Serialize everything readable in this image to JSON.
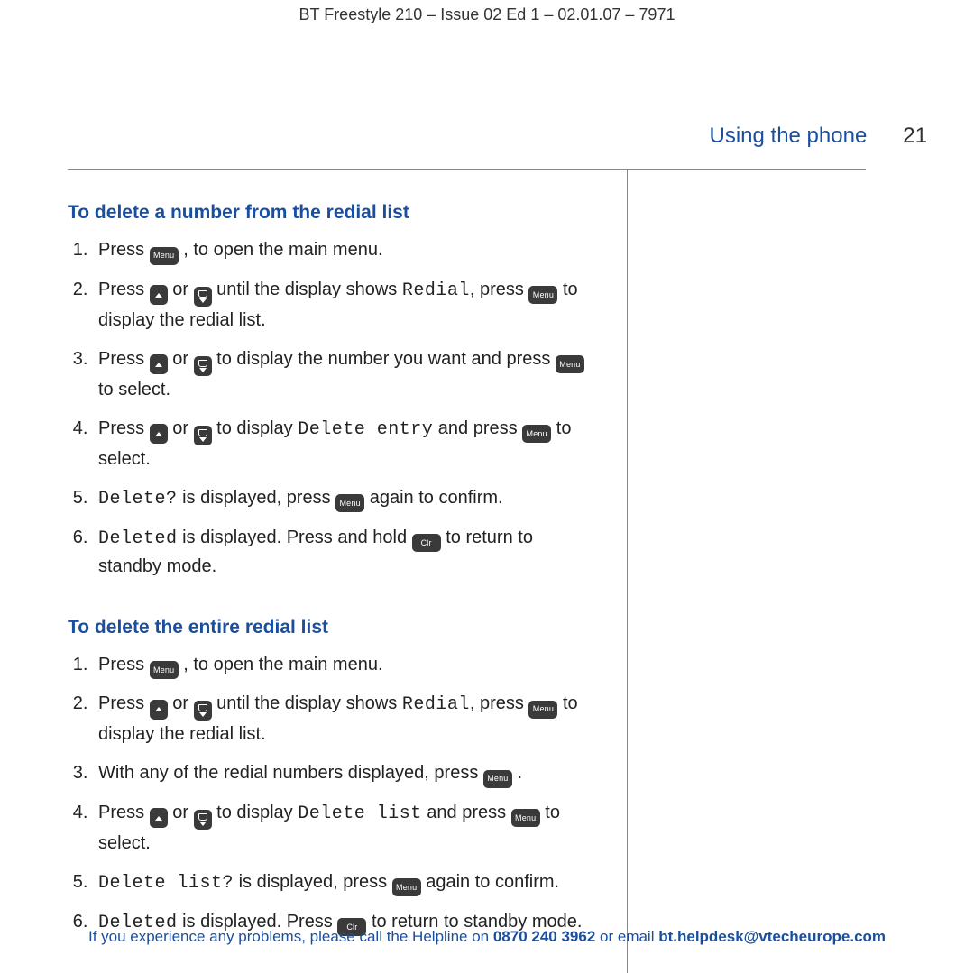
{
  "doc_header": "BT Freestyle 210 – Issue 02 Ed 1 – 02.01.07 – 7971",
  "section_title": "Using the phone",
  "page_number": "21",
  "button_labels": {
    "menu": "Menu",
    "clr": "Clr"
  },
  "section1": {
    "heading": "To delete a number from the redial list",
    "steps": {
      "s1a": "Press ",
      "s1b": " , to open the main menu.",
      "s2a": "Press ",
      "s2b": " or ",
      "s2c": " until the display shows ",
      "s2_lcd": "Redial",
      "s2d": ", press ",
      "s2e": " to display the redial list.",
      "s3a": "Press ",
      "s3b": " or ",
      "s3c": " to display the number you want and press ",
      "s3d": " to select.",
      "s4a": "Press ",
      "s4b": " or ",
      "s4c": " to display ",
      "s4_lcd": "Delete entry",
      "s4d": " and press ",
      "s4e": " to select.",
      "s5_lcd": "Delete?",
      "s5a": " is displayed, press ",
      "s5b": " again to confirm.",
      "s6_lcd": "Deleted",
      "s6a": " is displayed. Press and hold ",
      "s6b": " to return to standby mode."
    }
  },
  "section2": {
    "heading": "To delete the entire redial list",
    "steps": {
      "s1a": "Press ",
      "s1b": " , to open the main menu.",
      "s2a": "Press ",
      "s2b": " or ",
      "s2c": " until the display shows ",
      "s2_lcd": "Redial",
      "s2d": ", press ",
      "s2e": " to display the redial list.",
      "s3a": "With any of the redial numbers displayed, press ",
      "s3b": " .",
      "s4a": "Press ",
      "s4b": " or ",
      "s4c": " to display ",
      "s4_lcd": "Delete list",
      "s4d": " and press ",
      "s4e": " to select.",
      "s5_lcd": "Delete list?",
      "s5a": " is displayed, press ",
      "s5b": " again to confirm.",
      "s6_lcd": "Deleted",
      "s6a": " is displayed. Press ",
      "s6b": " to return to standby mode."
    }
  },
  "footer": {
    "pre": "If you experience any problems, please call the Helpline on ",
    "phone": "0870 240 3962",
    "mid": " or email ",
    "email": "bt.helpdesk@vtecheurope.com"
  }
}
